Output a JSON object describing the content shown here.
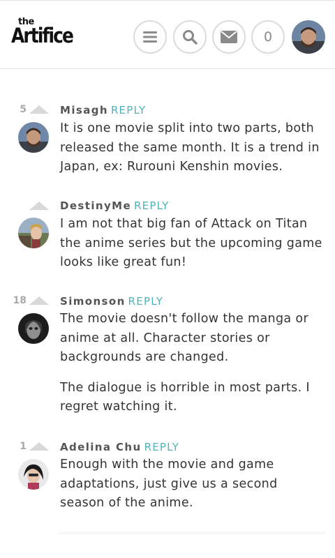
{
  "header": {
    "logo_small": "the",
    "logo_main": "Artifice",
    "menu_icon": "menu-icon",
    "search_icon": "search-icon",
    "mail_icon": "envelope-icon",
    "notification_count": "0",
    "accent_color": "#4fb2b7"
  },
  "comments": [
    {
      "votes": "5",
      "author": "Misagh",
      "reply_label": "REPLY",
      "paragraphs": [
        "It is one movie split into two parts, both released the same month. It is a trend in Japan, ex: Rurouni Kenshin movies."
      ]
    },
    {
      "votes": "",
      "author": "DestinyMe",
      "reply_label": "REPLY",
      "paragraphs": [
        "I am not that big fan of Attack on Titan the anime series but the upcoming game looks like great fun!"
      ]
    },
    {
      "votes": "18",
      "author": "Simonson",
      "reply_label": "REPLY",
      "paragraphs": [
        "The movie doesn't follow the manga or anime at all. Character stories or backgrounds are changed.",
        "The dialogue is horrible in most parts. I regret watching it."
      ]
    },
    {
      "votes": "1",
      "author": "Adelina Chu",
      "reply_label": "REPLY",
      "paragraphs": [
        "Enough with the movie and game adaptations, just give us a second season of the anime."
      ]
    }
  ]
}
